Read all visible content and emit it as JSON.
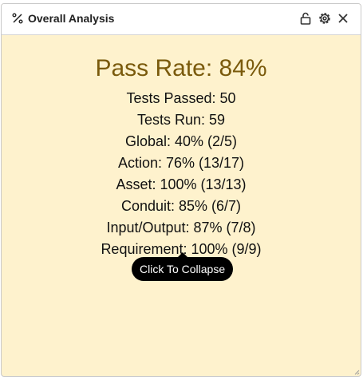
{
  "window": {
    "title": "Overall Analysis",
    "title_icon": "percent-icon",
    "buttons": [
      "lock-icon",
      "gear-icon",
      "close-icon"
    ]
  },
  "analysis": {
    "pass_rate": "Pass Rate: 84%",
    "stats": [
      "Tests Passed: 50",
      "Tests Run: 59",
      "Global: 40% (2/5)",
      "Action: 76% (13/17)",
      "Asset: 100% (13/13)",
      "Conduit: 85% (6/7)",
      "Input/Output: 87% (7/8)",
      "Requirement: 100% (9/9)"
    ]
  },
  "tooltip": {
    "label": "Click To Collapse"
  },
  "colors": {
    "panel_background": "#fef2cd",
    "pass_rate_text": "#7a5a0c"
  }
}
